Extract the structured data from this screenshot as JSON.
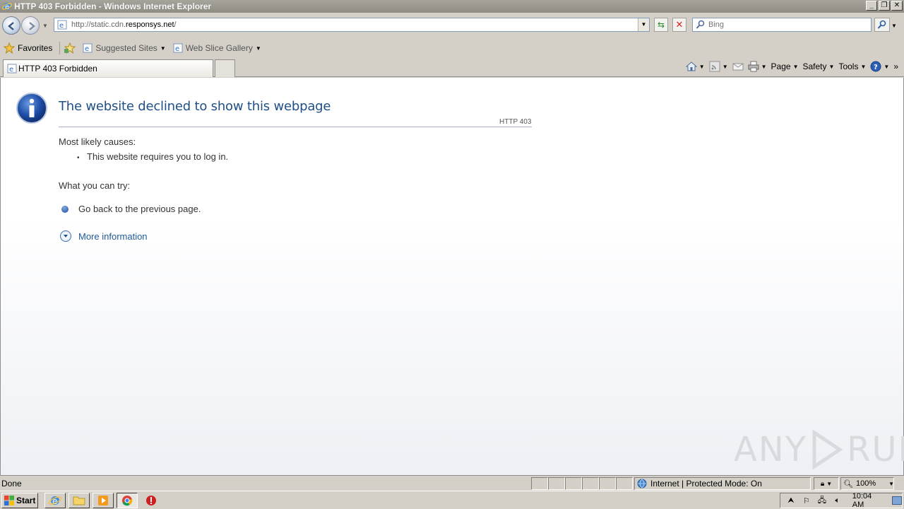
{
  "window": {
    "title": "HTTP 403 Forbidden - Windows Internet Explorer"
  },
  "addressbar": {
    "url_prefix": "http://static.cdn.",
    "url_domain": "responsys.net",
    "url_suffix": "/"
  },
  "search": {
    "placeholder": "Bing"
  },
  "favorites": {
    "label": "Favorites",
    "items": [
      {
        "label": "Suggested Sites"
      },
      {
        "label": "Web Slice Gallery"
      }
    ]
  },
  "tabs": [
    {
      "label": "HTTP 403 Forbidden"
    }
  ],
  "commandbar": {
    "page": "Page",
    "safety": "Safety",
    "tools": "Tools"
  },
  "page": {
    "heading": "The website declined to show this webpage",
    "http_code": "HTTP 403",
    "causes_label": "Most likely causes:",
    "causes": [
      "This website requires you to log in."
    ],
    "try_label": "What you can try:",
    "try_items": [
      "Go back to the previous page."
    ],
    "more_info": "More information"
  },
  "watermark": {
    "left": "ANY",
    "right": "RUN"
  },
  "statusbar": {
    "status": "Done",
    "zone": "Internet | Protected Mode: On",
    "zoom": "100%"
  },
  "taskbar": {
    "start": "Start",
    "clock": "10:04 AM"
  },
  "colors": {
    "heading": "#1f4f87",
    "link": "#1f5b99",
    "chrome": "#d4d0c8"
  }
}
